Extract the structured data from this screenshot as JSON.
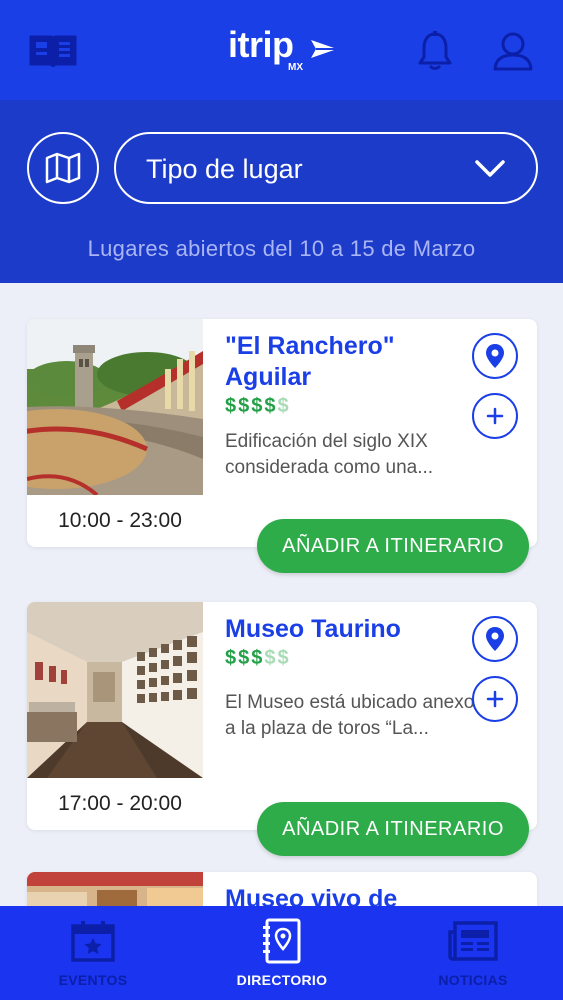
{
  "header": {
    "logo_text": "itrip",
    "logo_sub": "MX",
    "icons": [
      "guide-book-icon",
      "bell-icon",
      "user-icon"
    ]
  },
  "filters": {
    "map_icon": "map-icon",
    "place_type_label": "Tipo de lugar",
    "dates_text": "Lugares abiertos del 10 a 15 de Marzo"
  },
  "places": [
    {
      "title": "\"El Ranchero\" Aguilar",
      "price_active": "$$$$",
      "price_inactive": "$",
      "description": "Edificación del  siglo XIX considerada como una...",
      "hours": "10:00 - 23:00",
      "add_label": "AÑADIR A ITINERARIO"
    },
    {
      "title": "Museo Taurino",
      "price_active": "$$$",
      "price_inactive": "$$",
      "description": "El Museo está ubicado anexo a la plaza de toros “La...",
      "hours": "17:00 - 20:00",
      "add_label": "AÑADIR A ITINERARIO"
    },
    {
      "title": "Museo vivo de"
    }
  ],
  "nav": {
    "items": [
      {
        "label": "EVENTOS",
        "icon": "calendar-star-icon",
        "active": false
      },
      {
        "label": "DIRECTORIO",
        "icon": "directory-pin-icon",
        "active": true
      },
      {
        "label": "NOTICIAS",
        "icon": "newspaper-icon",
        "active": false
      }
    ]
  },
  "colors": {
    "primary": "#1b3fe6",
    "panel": "#1d3bc9",
    "nav": "#1a34f0",
    "accent_green": "#2fac4a",
    "background": "#eceef8"
  }
}
